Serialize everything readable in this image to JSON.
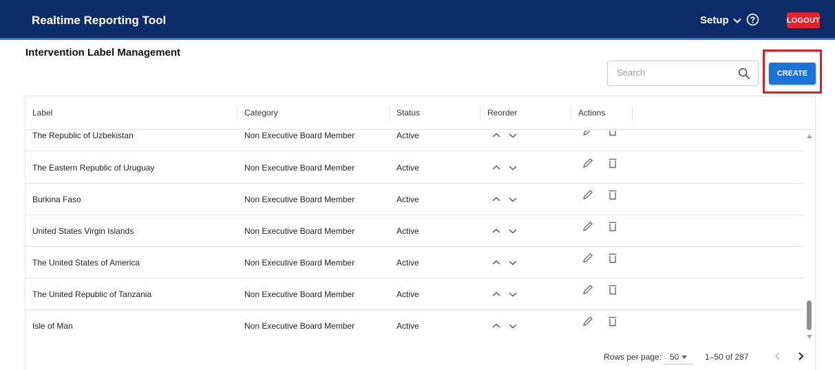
{
  "app": {
    "title": "Realtime Reporting Tool",
    "setup_label": "Setup",
    "logout_label": "LOGOUT"
  },
  "page": {
    "title": "Intervention Label Management"
  },
  "search": {
    "placeholder": "Search",
    "value": ""
  },
  "toolbar": {
    "create_label": "CREATE"
  },
  "table": {
    "columns": [
      "Label",
      "Category",
      "Status",
      "Reorder",
      "Actions"
    ],
    "rows": [
      {
        "label": "The Republic of Uzbekistan",
        "category": "Non Executive Board Member",
        "status": "Active"
      },
      {
        "label": "The Eastern Republic of Uruguay",
        "category": "Non Executive Board Member",
        "status": "Active"
      },
      {
        "label": "Burkina Faso",
        "category": "Non Executive Board Member",
        "status": "Active"
      },
      {
        "label": "United States Virgin Islands",
        "category": "Non Executive Board Member",
        "status": "Active"
      },
      {
        "label": "The United States of America",
        "category": "Non Executive Board Member",
        "status": "Active"
      },
      {
        "label": "The United Republic of Tanzania",
        "category": "Non Executive Board Member",
        "status": "Active"
      },
      {
        "label": "Isle of Man",
        "category": "Non Executive Board Member",
        "status": "Active"
      }
    ]
  },
  "pagination": {
    "rows_per_page_label": "Rows per page:",
    "rows_per_page": "50",
    "range": "1–50 of 287"
  },
  "colors": {
    "header_bg": "#0b2b69",
    "logout_bg": "#e8202a",
    "create_bg": "#1c73d6",
    "highlight": "#e11b22"
  },
  "icons": [
    "chevron-down-icon",
    "help-icon",
    "search-icon",
    "chevron-up-icon",
    "pencil-icon",
    "trash-icon",
    "chevron-left-icon",
    "chevron-right-icon"
  ]
}
